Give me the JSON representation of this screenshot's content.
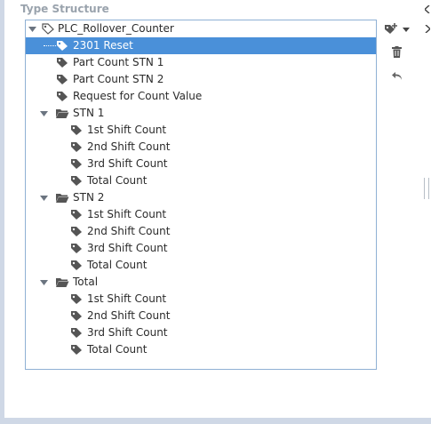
{
  "panel": {
    "title": "Type Structure"
  },
  "tree": {
    "root": "PLC_Rollover_Counter",
    "items": [
      "2301 Reset",
      "Part Count STN 1",
      "Part Count STN 2",
      "Request for Count Value"
    ],
    "folders": [
      {
        "name": "STN 1",
        "children": [
          "1st Shift Count",
          "2nd Shift Count",
          "3rd Shift Count",
          "Total Count"
        ]
      },
      {
        "name": "STN 2",
        "children": [
          "1st Shift Count",
          "2nd Shift Count",
          "3rd Shift Count",
          "Total Count"
        ]
      },
      {
        "name": "Total",
        "children": [
          "1st Shift Count",
          "2nd Shift Count",
          "3rd Shift Count",
          "Total Count"
        ]
      }
    ],
    "selected": "2301 Reset"
  },
  "toolbar": {
    "add_icon": "add-tag-icon",
    "dropdown_icon": "chevron-down-icon",
    "delete_icon": "trash-icon",
    "undo_icon": "undo-icon"
  },
  "colors": {
    "selection": "#4a90d9",
    "border": "#8fb0d4",
    "title": "#9aa3ad"
  }
}
